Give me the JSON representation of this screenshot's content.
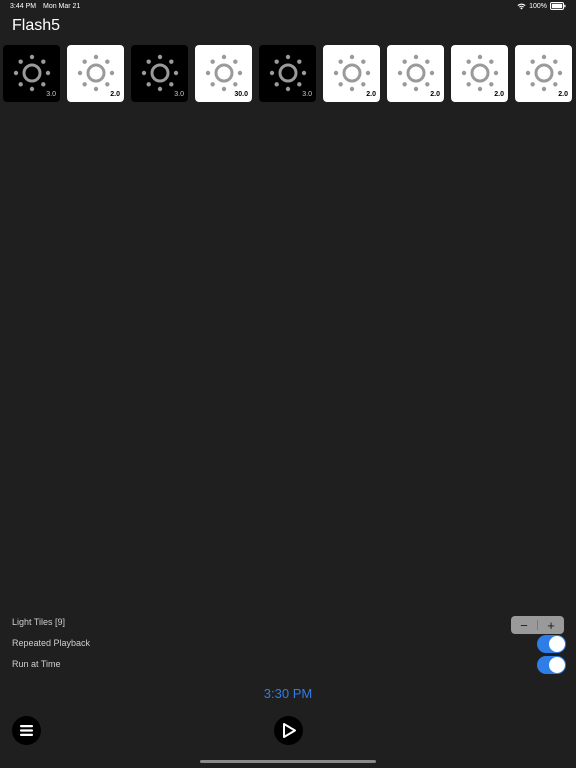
{
  "status_bar": {
    "time": "3:44 PM",
    "date": "Mon Mar 21",
    "battery_text": "100%",
    "icons": [
      "wifi-icon",
      "battery-icon"
    ]
  },
  "app": {
    "title": "Flash5"
  },
  "tiles": [
    {
      "style": "dark",
      "value": "3.0",
      "icon": "light-bulb-icon"
    },
    {
      "style": "light",
      "value": "2.0",
      "icon": "light-bulb-icon"
    },
    {
      "style": "dark",
      "value": "3.0",
      "icon": "light-bulb-icon"
    },
    {
      "style": "light",
      "value": "30.0",
      "icon": "light-bulb-icon"
    },
    {
      "style": "dark",
      "value": "3.0",
      "icon": "light-bulb-icon"
    },
    {
      "style": "light",
      "value": "2.0",
      "icon": "light-bulb-icon"
    },
    {
      "style": "light",
      "value": "2.0",
      "icon": "light-bulb-icon"
    },
    {
      "style": "light",
      "value": "2.0",
      "icon": "light-bulb-icon"
    },
    {
      "style": "light",
      "value": "2.0",
      "icon": "light-bulb-icon"
    }
  ],
  "settings": {
    "light_tiles_label": "Light Tiles [9]",
    "stepper_minus": "−",
    "stepper_plus": "+",
    "repeated_playback_label": "Repeated Playback",
    "repeated_playback_on": true,
    "run_at_time_label": "Run at Time",
    "run_at_time_on": true
  },
  "run_time": "3:30 PM",
  "toolbar": {
    "menu_icon": "menu-icon",
    "play_icon": "play-icon"
  },
  "colors": {
    "background": "#1f1f1f",
    "accent": "#2f7de6",
    "tile_dark": "#000000",
    "tile_light": "#ffffff",
    "bulb": "#9a9a9a"
  }
}
